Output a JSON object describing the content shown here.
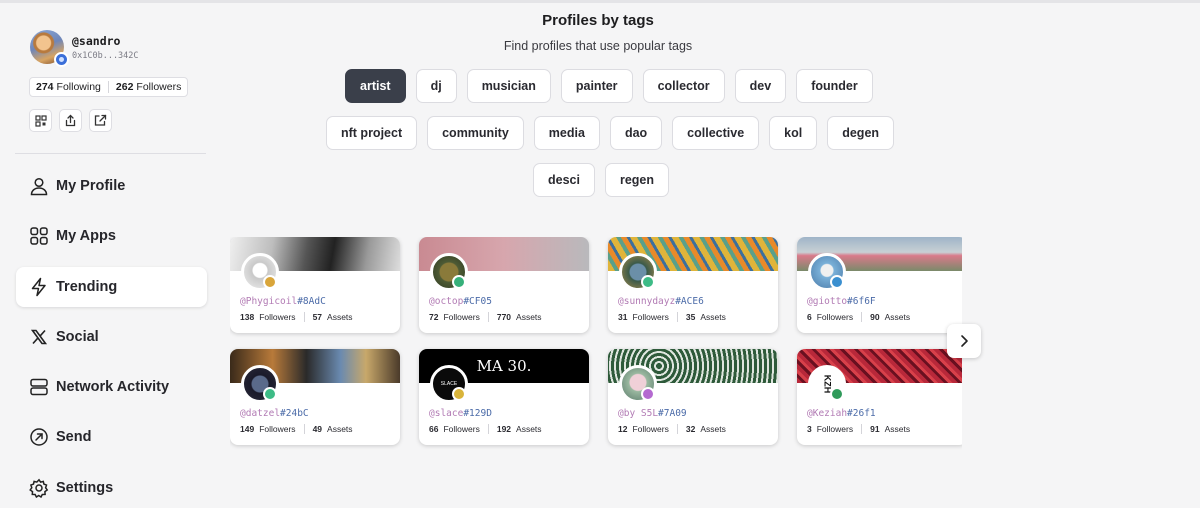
{
  "user": {
    "handle": "@sandro",
    "address": "0x1C0b...342C",
    "following_count": "274",
    "following_label": "Following",
    "followers_count": "262",
    "followers_label": "Followers"
  },
  "nav": {
    "items": [
      {
        "label": "My Profile",
        "icon": "user-icon"
      },
      {
        "label": "My Apps",
        "icon": "apps-grid-icon"
      },
      {
        "label": "Trending",
        "icon": "lightning-icon",
        "active": true
      },
      {
        "label": "Social",
        "icon": "x-logo-icon"
      },
      {
        "label": "Network Activity",
        "icon": "server-icon"
      },
      {
        "label": "Send",
        "icon": "send-arrow-icon"
      },
      {
        "label": "Settings",
        "icon": "gear-icon"
      }
    ]
  },
  "main": {
    "title": "Profiles by tags",
    "subtitle": "Find profiles that use popular tags",
    "tags_row1": [
      "artist",
      "dj",
      "musician",
      "painter",
      "collector",
      "dev",
      "founder"
    ],
    "tags_row2": [
      "nft project",
      "community",
      "media",
      "dao",
      "collective",
      "kol",
      "degen"
    ],
    "tags_row3": [
      "desci",
      "regen"
    ],
    "active_tag": "artist"
  },
  "cards": [
    {
      "handle": "@Phygicoil",
      "tag": "#8AdC",
      "followers": "138",
      "assets": "57"
    },
    {
      "handle": "@octop",
      "tag": "#CF05",
      "followers": "72",
      "assets": "770"
    },
    {
      "handle": "@sunnydayz",
      "tag": "#ACE6",
      "followers": "31",
      "assets": "35"
    },
    {
      "handle": "@giotto",
      "tag": "#6f6F",
      "followers": "6",
      "assets": "90"
    },
    {
      "handle": "@datzel",
      "tag": "#24bC",
      "followers": "149",
      "assets": "49"
    },
    {
      "handle": "@slace",
      "tag": "#129D",
      "followers": "66",
      "assets": "192"
    },
    {
      "handle": "@by S5L",
      "tag": "#7A09",
      "followers": "12",
      "assets": "32"
    },
    {
      "handle": "@Keziah",
      "tag": "#26f1",
      "followers": "3",
      "assets": "91"
    }
  ],
  "card_labels": {
    "followers": "Followers",
    "assets": "Assets"
  },
  "card_art": {
    "slace_banner_text": "MA 30.",
    "slace_avatar_text": "SLACE",
    "keziah_avatar_text": "KZH"
  }
}
